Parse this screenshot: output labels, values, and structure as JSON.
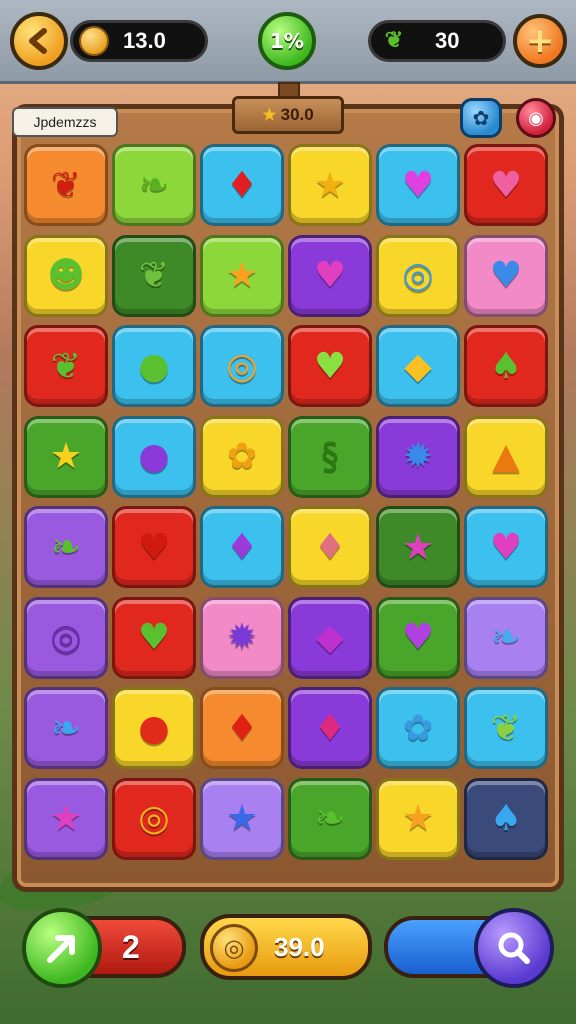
{
  "header": {
    "coins_value": "13.0",
    "progress_label": "1%",
    "leaves_value": "30",
    "add_label": "+"
  },
  "board": {
    "level_label": "Jpdemzzs",
    "sign_value": "30.0"
  },
  "footer": {
    "moves_value": "2",
    "score_value": "39.0"
  },
  "colors": {
    "orange": "#f58a2e",
    "lime": "#8cd83a",
    "sky": "#3cc0ee",
    "yellow": "#f8d62a",
    "red": "#e0281e",
    "green": "#4aa62a",
    "darkgreen": "#3f8a28",
    "purple": "#8a3ad8",
    "violet": "#9a5ae0",
    "pink": "#f28ac8",
    "navy": "#3a4a7a",
    "lilac": "#a880f0"
  },
  "tiles": [
    [
      {
        "color": "orange",
        "icon": "leaf-icon",
        "glyph": "❦",
        "fg": "#d02010"
      },
      {
        "color": "lime",
        "icon": "leaf-icon",
        "glyph": "❧",
        "fg": "#5ab020"
      },
      {
        "color": "sky",
        "icon": "chili-icon",
        "glyph": "♦",
        "fg": "#e02020"
      },
      {
        "color": "yellow",
        "icon": "star-icon",
        "glyph": "★",
        "fg": "#f0b010"
      },
      {
        "color": "sky",
        "icon": "heart-icon",
        "glyph": "♥",
        "fg": "#e040e0"
      },
      {
        "color": "red",
        "icon": "heart-icon",
        "glyph": "♥",
        "fg": "#f060a0"
      }
    ],
    [
      {
        "color": "yellow",
        "icon": "face-icon",
        "glyph": "☻",
        "fg": "#5ac030"
      },
      {
        "color": "darkgreen",
        "icon": "leaf-icon",
        "glyph": "❦",
        "fg": "#70c040"
      },
      {
        "color": "lime",
        "icon": "star-icon",
        "glyph": "★",
        "fg": "#f8a020"
      },
      {
        "color": "purple",
        "icon": "heart-icon",
        "glyph": "♥",
        "fg": "#e040c0"
      },
      {
        "color": "yellow",
        "icon": "swirl-icon",
        "glyph": "◎",
        "fg": "#3a9ae0"
      },
      {
        "color": "pink",
        "icon": "heart-icon",
        "glyph": "♥",
        "fg": "#3a8ae8"
      }
    ],
    [
      {
        "color": "red",
        "icon": "leaf-icon",
        "glyph": "❦",
        "fg": "#5ac030"
      },
      {
        "color": "sky",
        "icon": "leaf-icon",
        "glyph": "●",
        "fg": "#5ac030"
      },
      {
        "color": "sky",
        "icon": "swirl-icon",
        "glyph": "◎",
        "fg": "#f8a020"
      },
      {
        "color": "red",
        "icon": "leaf-icon",
        "glyph": "♥",
        "fg": "#8ae040"
      },
      {
        "color": "sky",
        "icon": "leaf-icon",
        "glyph": "◆",
        "fg": "#f8c020"
      },
      {
        "color": "red",
        "icon": "chili-icon",
        "glyph": "♠",
        "fg": "#5ac030"
      }
    ],
    [
      {
        "color": "green",
        "icon": "star-icon",
        "glyph": "★",
        "fg": "#f8d020"
      },
      {
        "color": "sky",
        "icon": "leaf-icon",
        "glyph": "●",
        "fg": "#8a3ad8"
      },
      {
        "color": "yellow",
        "icon": "flower-icon",
        "glyph": "✿",
        "fg": "#f0a010"
      },
      {
        "color": "green",
        "icon": "swirl-icon",
        "glyph": "§",
        "fg": "#2a7a10"
      },
      {
        "color": "purple",
        "icon": "star-icon",
        "glyph": "✹",
        "fg": "#3a8ae8"
      },
      {
        "color": "yellow",
        "icon": "triangle-icon",
        "glyph": "▲",
        "fg": "#e87a10"
      }
    ],
    [
      {
        "color": "violet",
        "icon": "leaf-icon",
        "glyph": "❧",
        "fg": "#5ac030"
      },
      {
        "color": "red",
        "icon": "heart-icon",
        "glyph": "♥",
        "fg": "#d01a10"
      },
      {
        "color": "sky",
        "icon": "chili-icon",
        "glyph": "♦",
        "fg": "#9a3ad8"
      },
      {
        "color": "yellow",
        "icon": "chili-icon",
        "glyph": "♦",
        "fg": "#e07080"
      },
      {
        "color": "darkgreen",
        "icon": "star-icon",
        "glyph": "★",
        "fg": "#e040c0"
      },
      {
        "color": "sky",
        "icon": "heart-icon",
        "glyph": "♥",
        "fg": "#e040c0"
      }
    ],
    [
      {
        "color": "violet",
        "icon": "swirl-icon",
        "glyph": "◎",
        "fg": "#6a2ab0"
      },
      {
        "color": "red",
        "icon": "heart-icon",
        "glyph": "♥",
        "fg": "#5ac030"
      },
      {
        "color": "pink",
        "icon": "star-icon",
        "glyph": "✹",
        "fg": "#7a3ad8"
      },
      {
        "color": "purple",
        "icon": "heart-icon",
        "glyph": "◆",
        "fg": "#c030d0"
      },
      {
        "color": "green",
        "icon": "leaf-icon",
        "glyph": "♥",
        "fg": "#b040e0"
      },
      {
        "color": "lilac",
        "icon": "leaf-icon",
        "glyph": "❧",
        "fg": "#4aa8f0"
      }
    ],
    [
      {
        "color": "violet",
        "icon": "leaf-icon",
        "glyph": "❧",
        "fg": "#3aa8f0"
      },
      {
        "color": "yellow",
        "icon": "balloon-icon",
        "glyph": "●",
        "fg": "#e02a1a"
      },
      {
        "color": "orange",
        "icon": "chili-icon",
        "glyph": "♦",
        "fg": "#e02010"
      },
      {
        "color": "purple",
        "icon": "chili-icon",
        "glyph": "♦",
        "fg": "#e02a80"
      },
      {
        "color": "sky",
        "icon": "flower-icon",
        "glyph": "✿",
        "fg": "#3a9ae0"
      },
      {
        "color": "sky",
        "icon": "leaf-icon",
        "glyph": "❦",
        "fg": "#8ad040"
      }
    ],
    [
      {
        "color": "violet",
        "icon": "star-icon",
        "glyph": "★",
        "fg": "#e040c0"
      },
      {
        "color": "red",
        "icon": "swirl-icon",
        "glyph": "◎",
        "fg": "#f8b020"
      },
      {
        "color": "lilac",
        "icon": "star-icon",
        "glyph": "★",
        "fg": "#3a6ae8"
      },
      {
        "color": "green",
        "icon": "leaf-icon",
        "glyph": "❧",
        "fg": "#5ac030"
      },
      {
        "color": "yellow",
        "icon": "star-icon",
        "glyph": "★",
        "fg": "#f8a020"
      },
      {
        "color": "navy",
        "icon": "plug-icon",
        "glyph": "♠",
        "fg": "#3aa8f0"
      }
    ]
  ]
}
